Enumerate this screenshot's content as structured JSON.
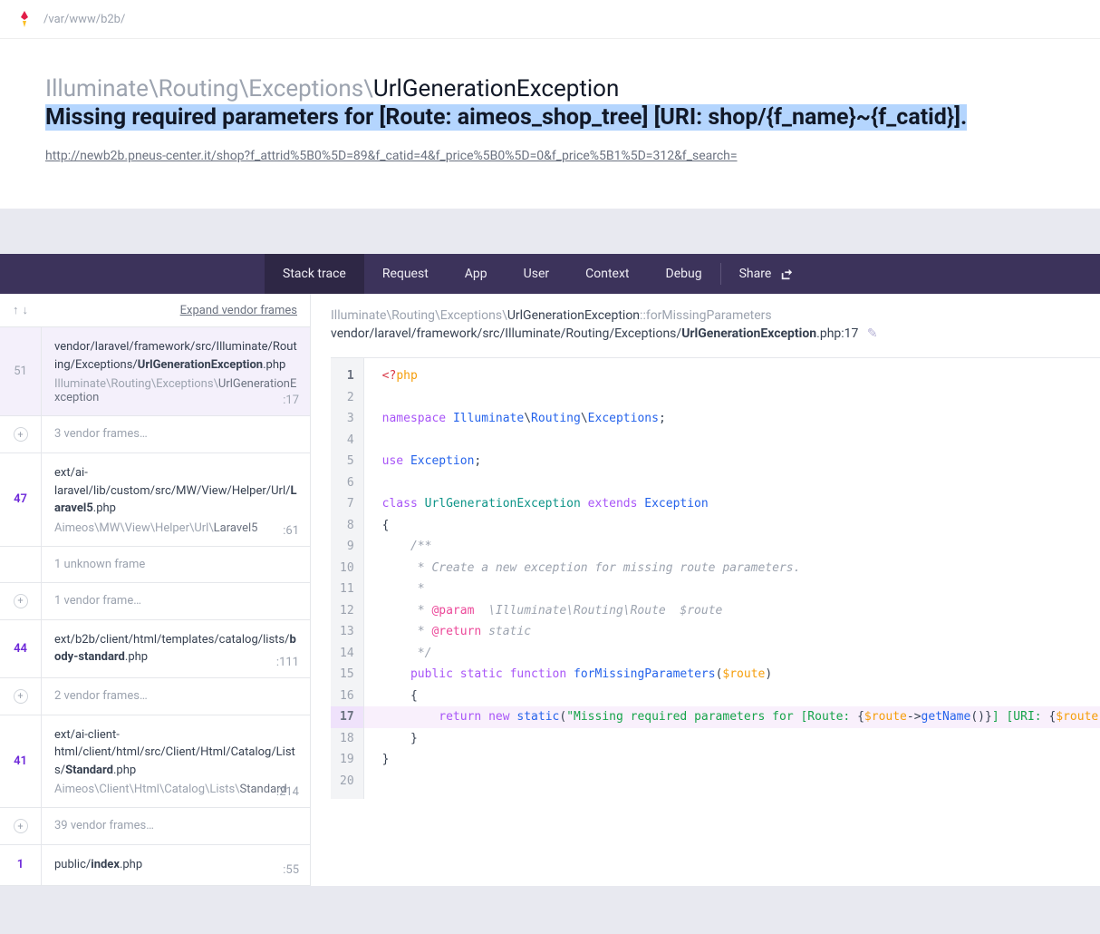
{
  "topbar": {
    "path": "/var/www/b2b/"
  },
  "exception": {
    "namespace": "Illuminate\\Routing\\Exceptions\\",
    "class": "UrlGenerationException",
    "message": "Missing required parameters for [Route: aimeos_shop_tree] [URI: shop/{f_name}~{f_catid}].",
    "url": "http://newb2b.pneus-center.it/shop?f_attrid%5B0%5D=89&f_catid=4&f_price%5B0%5D=0&f_price%5B1%5D=312&f_search="
  },
  "tabs": {
    "items": [
      "Stack trace",
      "Request",
      "App",
      "User",
      "Context",
      "Debug"
    ],
    "share": "Share"
  },
  "sidebar": {
    "expand_label": "Expand vendor frames",
    "frames": [
      {
        "type": "full",
        "num": "51",
        "hl": false,
        "path_pre": "vendor/laravel/framework/src/Illuminate/Routing/Exceptions/",
        "path_bold": "UrlGenerationException",
        "path_post": ".php",
        "cls_pre": "Illuminate\\Routing\\Exceptions\\",
        "cls_dark": "UrlGenerationException",
        "line": ":17",
        "selected": true
      },
      {
        "type": "collapsed",
        "label": "3 vendor frames…"
      },
      {
        "type": "full",
        "num": "47",
        "hl": true,
        "path_pre": "ext/ai-laravel/lib/custom/src/MW/View/Helper/Url/",
        "path_bold": "Laravel5",
        "path_post": ".php",
        "cls_pre": "Aimeos\\MW\\View\\Helper\\Url\\",
        "cls_dark": "Laravel5",
        "line": ":61"
      },
      {
        "type": "collapsed-plain",
        "label": "1 unknown frame"
      },
      {
        "type": "collapsed",
        "label": "1 vendor frame…"
      },
      {
        "type": "full",
        "num": "44",
        "hl": true,
        "path_pre": "ext/b2b/client/html/templates/catalog/lists/",
        "path_bold": "body-standard",
        "path_post": ".php",
        "cls_pre": "",
        "cls_dark": "",
        "line": ":111"
      },
      {
        "type": "collapsed",
        "label": "2 vendor frames…"
      },
      {
        "type": "full",
        "num": "41",
        "hl": true,
        "path_pre": "ext/ai-client-html/client/html/src/Client/Html/Catalog/Lists/",
        "path_bold": "Standard",
        "path_post": ".php",
        "cls_pre": "Aimeos\\Client\\Html\\Catalog\\Lists\\",
        "cls_dark": "Standard",
        "line": ":214"
      },
      {
        "type": "collapsed",
        "label": "39 vendor frames…"
      },
      {
        "type": "full-partial",
        "num": "1",
        "hl": true,
        "path_pre": "public/",
        "path_bold": "index",
        "path_post": ".php",
        "line": ":55"
      }
    ]
  },
  "codepane": {
    "header1_pre": "Illuminate\\Routing\\Exceptions\\",
    "header1_dark": "UrlGenerationException",
    "header1_post": "::forMissingParameters",
    "header2_pre": "vendor/laravel/framework/src/Illuminate/Routing/Exceptions/",
    "header2_bold": "UrlGenerationException",
    "header2_post": ".php:17",
    "lines": [
      1,
      2,
      3,
      4,
      5,
      6,
      7,
      8,
      9,
      10,
      11,
      12,
      13,
      14,
      15,
      16,
      17,
      18,
      19,
      20
    ],
    "highlight": 17
  }
}
